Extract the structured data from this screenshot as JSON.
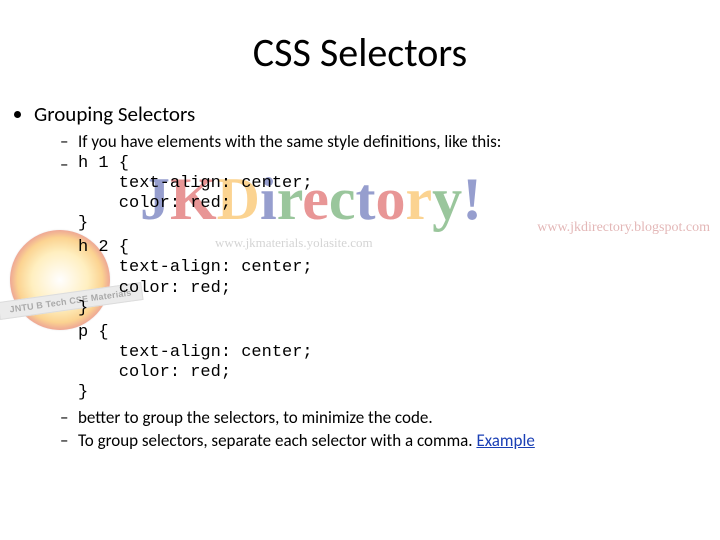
{
  "title": "CSS Selectors",
  "bullet1": "Grouping Selectors",
  "sub1": "If you have elements with the same style definitions, like this:",
  "code_h1": "h 1 {\n    text-align: center;\n    color: red;\n}",
  "code_h2": "h 2 {\n    text-align: center;\n    color: red;\n}",
  "code_p": "p {\n    text-align: center;\n    color: red;\n}",
  "sub2": "better to group the selectors, to minimize the code.",
  "sub3_prefix": "To group selectors, separate each selector with a comma. ",
  "sub3_link": "Example",
  "watermark": {
    "brand": "JKDirectory!",
    "badge_text": "JNTU B Tech CSE Materials",
    "url_left": "www.jkmaterials.yolasite.com",
    "url_right": "www.jkdirectory.blogspot.com"
  }
}
